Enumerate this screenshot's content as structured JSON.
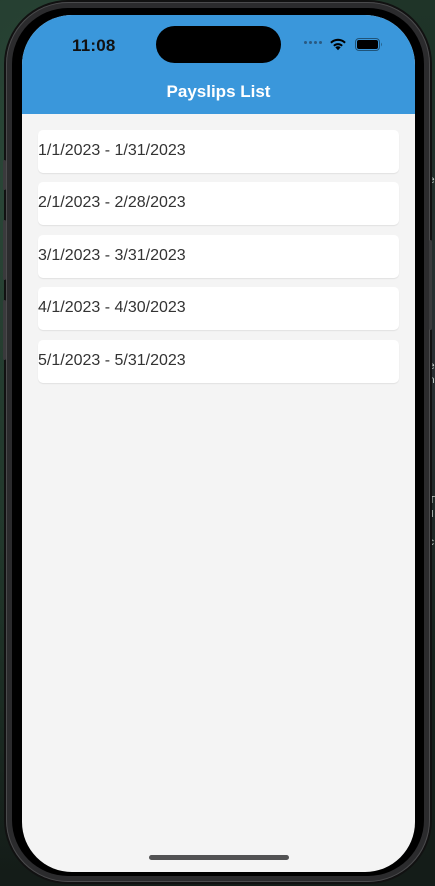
{
  "status_bar": {
    "time": "11:08",
    "wifi_icon": "wifi-icon",
    "battery_icon": "battery-icon"
  },
  "colors": {
    "header": "#3a97db",
    "screen_background": "#f4f4f4",
    "card": "#ffffff",
    "item_text": "#333333"
  },
  "header": {
    "title": "Payslips List"
  },
  "payslips": [
    {
      "label": "1/1/2023 - 1/31/2023"
    },
    {
      "label": "2/1/2023 - 2/28/2023"
    },
    {
      "label": "3/1/2023 - 3/31/2023"
    },
    {
      "label": "4/1/2023 - 4/30/2023"
    },
    {
      "label": "5/1/2023 - 5/31/2023"
    }
  ]
}
